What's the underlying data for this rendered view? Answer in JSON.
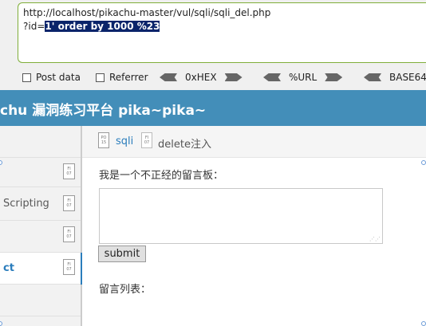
{
  "hackbar": {
    "url_line1": "http://localhost/pikachu-master/vul/sqli/sqli_del.php",
    "url_line2_prefix": "?id=",
    "url_line2_selected": "1' order by 1000 %23",
    "post_data_label": "Post data",
    "referrer_label": "Referrer",
    "hex_label": "0xHEX",
    "url_label": "%URL",
    "base64_label": "BASE64"
  },
  "header": {
    "title": "chu 漏洞练习平台 pika~pika~"
  },
  "sidebar": {
    "items": [
      {
        "label": ""
      },
      {
        "label": "Scripting"
      },
      {
        "label": ""
      },
      {
        "label": "ct"
      },
      {
        "label": ""
      }
    ],
    "file_icon_text": "FI\n07"
  },
  "breadcrumb": {
    "section": "sqli",
    "page": "delete注入",
    "icon_text": "PO\n15"
  },
  "main": {
    "board_label": "我是一个不正经的留言板：",
    "submit_label": "submit",
    "list_label": "留言列表："
  }
}
